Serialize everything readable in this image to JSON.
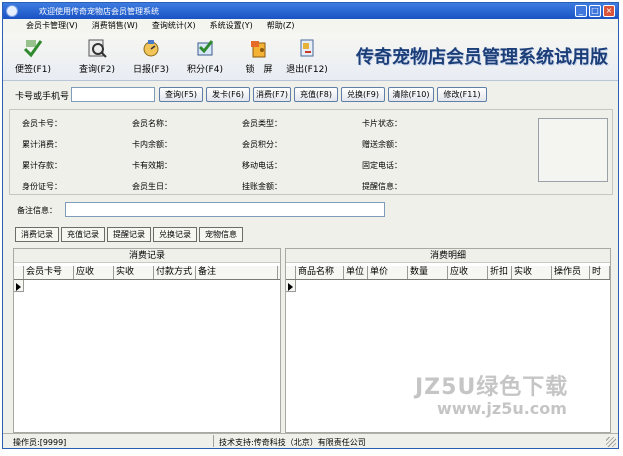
{
  "window": {
    "title": "欢迎使用传奇宠物店会员管理系统",
    "controls": [
      "_",
      "□",
      "×"
    ]
  },
  "menu": [
    "会员卡管理(V)",
    "消费销售(W)",
    "查询统计(X)",
    "系统设置(Y)",
    "帮助(Z)"
  ],
  "toolbar": {
    "buttons": [
      {
        "label": "便签(F1)",
        "icon": "memo-icon"
      },
      {
        "label": "查询(F2)",
        "icon": "query-icon"
      },
      {
        "label": "日报(F3)",
        "icon": "daily-report-icon"
      },
      {
        "label": "积分(F4)",
        "icon": "points-icon"
      },
      {
        "label": "锁　屏",
        "icon": "lock-screen-icon"
      },
      {
        "label": "退出(F12)",
        "icon": "exit-icon"
      }
    ],
    "banner": "传奇宠物店会员管理系统试用版"
  },
  "search": {
    "label": "卡号或手机号",
    "value": "",
    "buttons": [
      "查询(F5)",
      "发卡(F6)",
      "消费(F7)",
      "充值(F8)",
      "兑换(F9)",
      "清除(F10)",
      "修改(F11)"
    ]
  },
  "info": {
    "col1": [
      "会员卡号：",
      "累计消费：",
      "累计存款：",
      "身份证号："
    ],
    "col2": [
      "会员名称：",
      "卡内余额：",
      "卡有效期：",
      "会员生日："
    ],
    "col3": [
      "会员类型：",
      "会员积分：",
      "移动电话：",
      "挂账金额："
    ],
    "col4": [
      "卡片状态：",
      "赠送余额：",
      "固定电话：",
      "提醒信息："
    ]
  },
  "remarks": {
    "label": "备注信息：",
    "value": ""
  },
  "tabs": [
    "消费记录",
    "充值记录",
    "提醒记录",
    "兑换记录",
    "宠物信息"
  ],
  "left_grid": {
    "title": "消费记录",
    "columns": [
      "会员卡号",
      "应收",
      "实收",
      "付款方式",
      "备注"
    ]
  },
  "right_grid": {
    "title": "消费明细",
    "columns": [
      "商品名称",
      "单位",
      "单价",
      "数量",
      "应收",
      "折扣",
      "实收",
      "操作员",
      "时"
    ]
  },
  "status": {
    "operator": "操作员:[9999]",
    "support": "技术支持:传奇科技（北京）有限责任公司"
  },
  "watermark": {
    "line1": "JZ5U绿色下载",
    "line2": "www.jz5u.com"
  }
}
